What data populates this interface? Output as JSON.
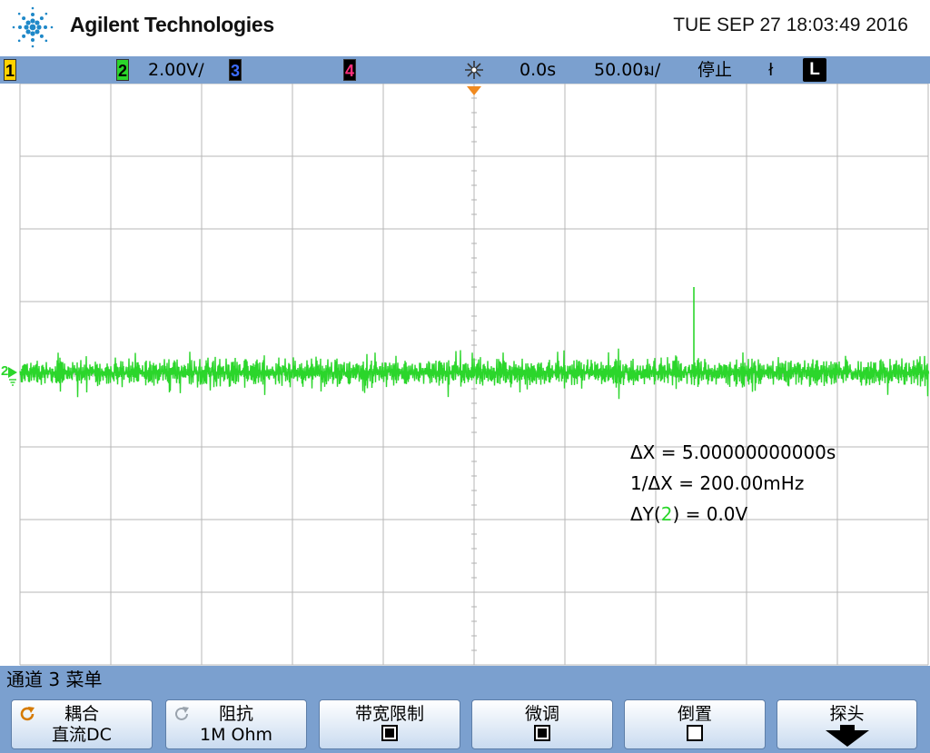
{
  "header": {
    "brand": "Agilent Technologies",
    "datetime": "TUE SEP 27 18:03:49 2016"
  },
  "status": {
    "ch1": "1",
    "ch2": "2",
    "ch2_scale": "2.00V/",
    "ch3": "3",
    "ch4": "4",
    "trigger_icon": "trigger-icon",
    "delay": "0.0s",
    "timebase": "50.00ม/",
    "run_state": "停止",
    "trigger_slope": "ł",
    "trigger_mode": "L"
  },
  "colors": {
    "ch1": "#ffd200",
    "ch2": "#2bd62b",
    "ch3": "#3c6dff",
    "ch4": "#ff2f7d",
    "bar": "#7ba0cf",
    "trace": "#2bd62b"
  },
  "trace": {
    "channel_marker": "2"
  },
  "measurements": {
    "dx": "ΔX = 5.00000000000s",
    "inv_dx": "1/ΔX = 200.00mHz",
    "dy_prefix": "ΔY(",
    "dy_channel": "2",
    "dy_suffix": ") = 0.0V"
  },
  "menu": {
    "title": "通道 3 菜单",
    "keys": [
      {
        "label": "耦合",
        "value": "直流DC",
        "icon": "rotate-knob-icon"
      },
      {
        "label": "阻抗",
        "value": "1M Ohm",
        "icon": "rotate-knob-icon"
      },
      {
        "label": "带宽限制",
        "checked": true
      },
      {
        "label": "微调",
        "checked": true
      },
      {
        "label": "倒置",
        "checked": false
      },
      {
        "label": "探头",
        "icon": "arrow-down-icon"
      }
    ]
  }
}
